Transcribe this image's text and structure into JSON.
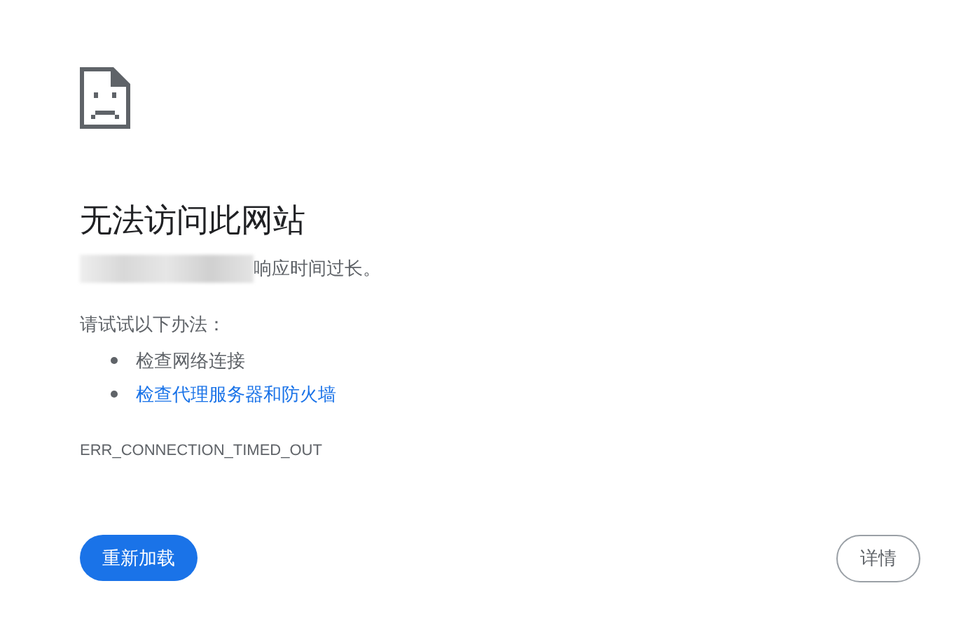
{
  "title": "无法访问此网站",
  "description": "响应时间过长。",
  "suggestions_heading": "请试试以下办法：",
  "suggestions": [
    {
      "text": "检查网络连接",
      "kind": "text"
    },
    {
      "text": "检查代理服务器和防火墙",
      "kind": "link"
    }
  ],
  "error_code": "ERR_CONNECTION_TIMED_OUT",
  "buttons": {
    "reload": "重新加载",
    "details": "详情"
  }
}
